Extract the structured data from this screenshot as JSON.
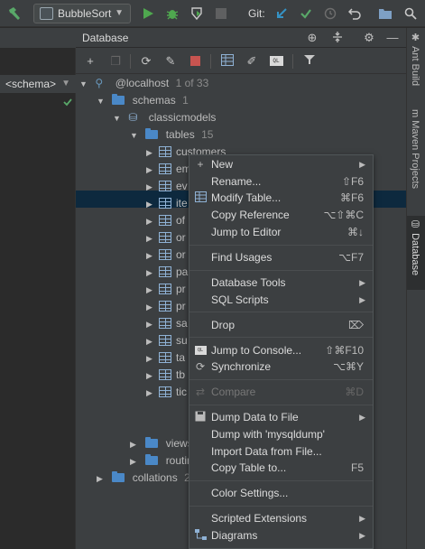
{
  "toolbar": {
    "run_config": "BubbleSort",
    "git_label": "Git:",
    "colors": {
      "run": "#4fa84f",
      "debug": "#4fa84f",
      "vcs_update": "#3592c4",
      "vcs_commit": "#59a869"
    }
  },
  "editor": {
    "schema_crumb": "<schema>"
  },
  "db_panel": {
    "title": "Database",
    "tree": {
      "host": "@localhost",
      "host_count": "1 of 33",
      "schemas": "schemas",
      "schemas_count": "1",
      "db": "classicmodels",
      "tables": "tables",
      "tables_count": "15",
      "table_items": [
        "customers",
        "em",
        "ev",
        "ite",
        "of",
        "or",
        "or",
        "pa",
        "pr",
        "pr",
        "sa",
        "su",
        "ta",
        "tb",
        "tic"
      ],
      "views": "views",
      "routines": "routin",
      "collations": "collations",
      "collations_count": "2"
    }
  },
  "right_stripe": {
    "ant": "Ant Build",
    "maven": "Maven Projects",
    "database": "Database"
  },
  "context_menu": [
    {
      "type": "item",
      "label": "New",
      "shortcut": "",
      "submenu": true,
      "icon": "plus-icon",
      "enabled": true
    },
    {
      "type": "item",
      "label": "Rename...",
      "shortcut": "⇧F6",
      "submenu": false,
      "icon": "",
      "enabled": true
    },
    {
      "type": "item",
      "label": "Modify Table...",
      "shortcut": "⌘F6",
      "submenu": false,
      "icon": "table-icon",
      "enabled": true
    },
    {
      "type": "item",
      "label": "Copy Reference",
      "shortcut": "⌥⇧⌘C",
      "submenu": false,
      "icon": "",
      "enabled": true
    },
    {
      "type": "item",
      "label": "Jump to Editor",
      "shortcut": "⌘↓",
      "submenu": false,
      "icon": "",
      "enabled": true
    },
    {
      "type": "sep"
    },
    {
      "type": "item",
      "label": "Find Usages",
      "shortcut": "⌥F7",
      "submenu": false,
      "icon": "",
      "enabled": true
    },
    {
      "type": "sep"
    },
    {
      "type": "item",
      "label": "Database Tools",
      "shortcut": "",
      "submenu": true,
      "icon": "",
      "enabled": true
    },
    {
      "type": "item",
      "label": "SQL Scripts",
      "shortcut": "",
      "submenu": true,
      "icon": "",
      "enabled": true
    },
    {
      "type": "sep"
    },
    {
      "type": "item",
      "label": "Drop",
      "shortcut": "⌦",
      "submenu": false,
      "icon": "",
      "enabled": true
    },
    {
      "type": "sep"
    },
    {
      "type": "item",
      "label": "Jump to Console...",
      "shortcut": "⇧⌘F10",
      "submenu": false,
      "icon": "console-icon",
      "enabled": true
    },
    {
      "type": "item",
      "label": "Synchronize",
      "shortcut": "⌥⌘Y",
      "submenu": false,
      "icon": "sync-icon",
      "enabled": true
    },
    {
      "type": "sep"
    },
    {
      "type": "item",
      "label": "Compare",
      "shortcut": "⌘D",
      "submenu": false,
      "icon": "compare-icon",
      "enabled": false
    },
    {
      "type": "sep"
    },
    {
      "type": "item",
      "label": "Dump Data to File",
      "shortcut": "",
      "submenu": true,
      "icon": "save-icon",
      "enabled": true
    },
    {
      "type": "item",
      "label": "Dump with 'mysqldump'",
      "shortcut": "",
      "submenu": false,
      "icon": "",
      "enabled": true
    },
    {
      "type": "item",
      "label": "Import Data from File...",
      "shortcut": "",
      "submenu": false,
      "icon": "",
      "enabled": true
    },
    {
      "type": "item",
      "label": "Copy Table to...",
      "shortcut": "F5",
      "submenu": false,
      "icon": "",
      "enabled": true
    },
    {
      "type": "sep"
    },
    {
      "type": "item",
      "label": "Color Settings...",
      "shortcut": "",
      "submenu": false,
      "icon": "",
      "enabled": true
    },
    {
      "type": "sep"
    },
    {
      "type": "item",
      "label": "Scripted Extensions",
      "shortcut": "",
      "submenu": true,
      "icon": "",
      "enabled": true
    },
    {
      "type": "item",
      "label": "Diagrams",
      "shortcut": "",
      "submenu": true,
      "icon": "diagram-icon",
      "enabled": true
    }
  ]
}
